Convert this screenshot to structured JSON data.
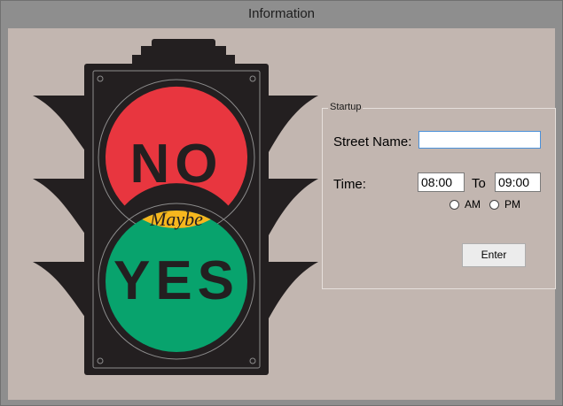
{
  "window": {
    "title": "Information"
  },
  "light": {
    "top_text": "NO",
    "middle_text": "Maybe",
    "bottom_text": "YES"
  },
  "colors": {
    "red": "#e8363f",
    "amber": "#f6b71e",
    "green": "#08a36d",
    "housing": "#231f20"
  },
  "startup": {
    "group_label": "Startup",
    "street_label": "Street Name:",
    "street_value": "",
    "time_label": "Time:",
    "from_time": "08:00",
    "to_label": "To",
    "to_time": "09:00",
    "am_label": "AM",
    "pm_label": "PM",
    "am_selected": false,
    "pm_selected": false,
    "enter_label": "Enter"
  }
}
